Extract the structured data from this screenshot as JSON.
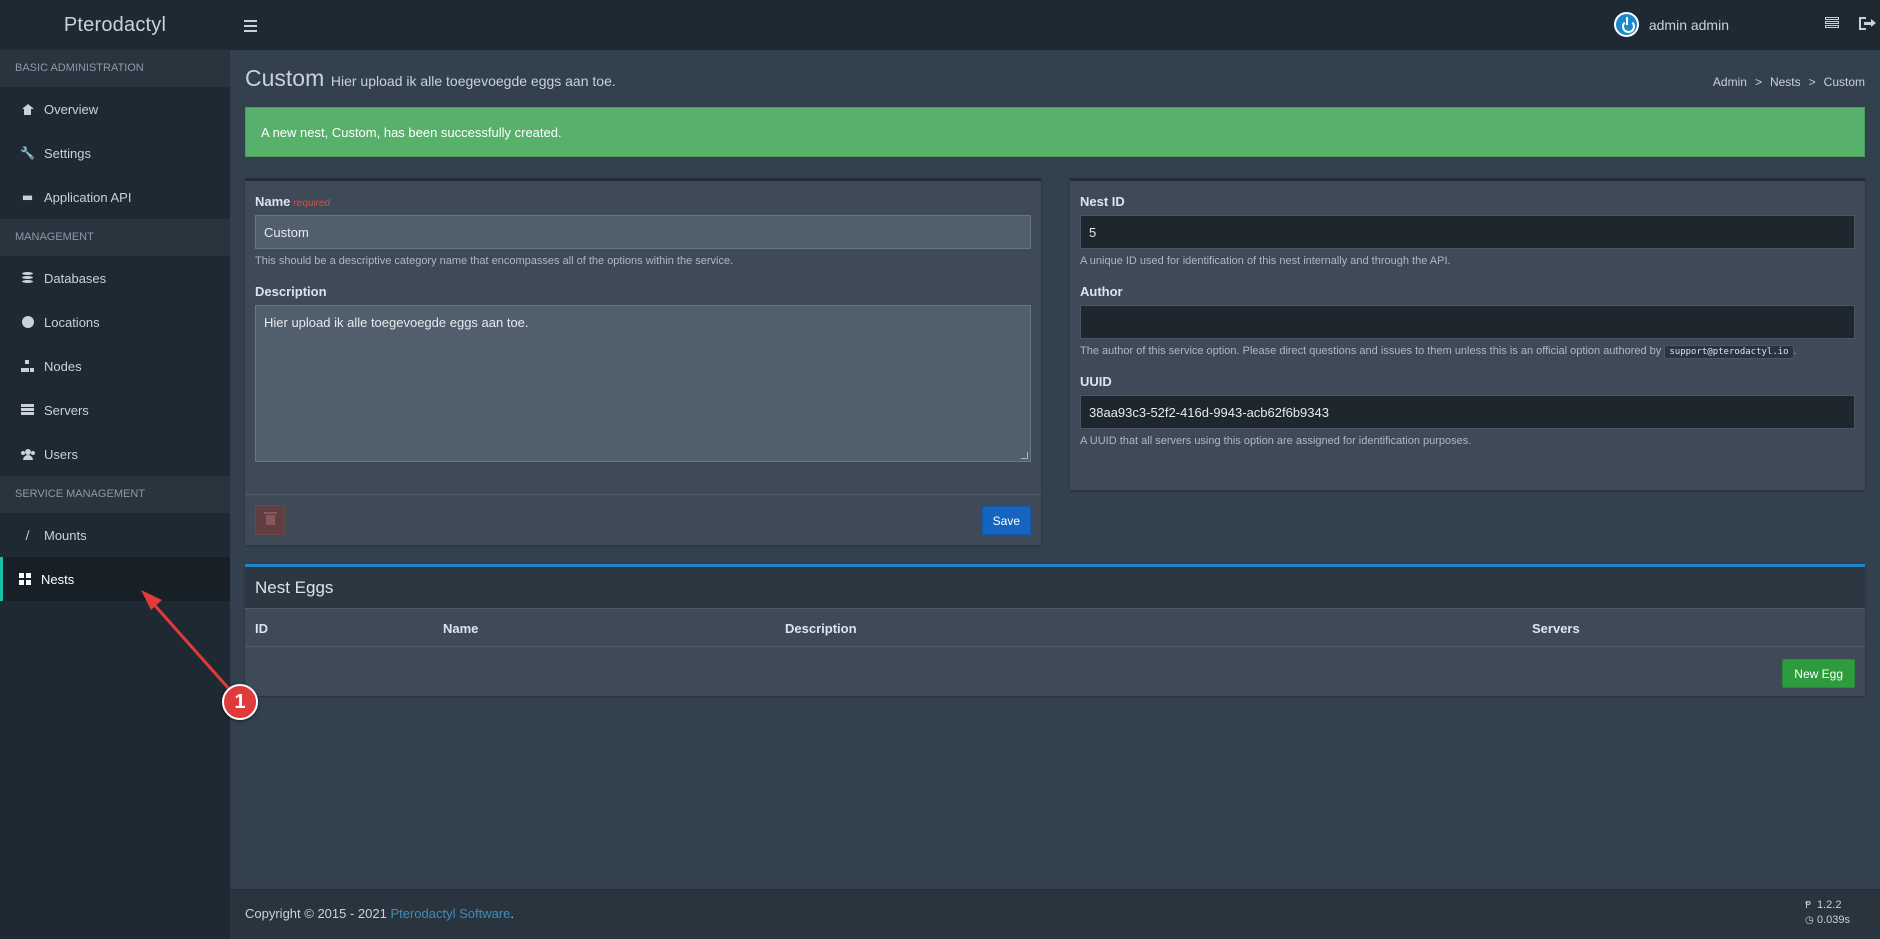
{
  "app": {
    "brand": "Pterodactyl"
  },
  "header": {
    "user_name": "admin admin"
  },
  "sidebar": {
    "sections": [
      {
        "title": "BASIC ADMINISTRATION",
        "items": [
          {
            "label": "Overview"
          },
          {
            "label": "Settings"
          },
          {
            "label": "Application API"
          }
        ]
      },
      {
        "title": "MANAGEMENT",
        "items": [
          {
            "label": "Databases"
          },
          {
            "label": "Locations"
          },
          {
            "label": "Nodes"
          },
          {
            "label": "Servers"
          },
          {
            "label": "Users"
          }
        ]
      },
      {
        "title": "SERVICE MANAGEMENT",
        "items": [
          {
            "label": "Mounts"
          },
          {
            "label": "Nests",
            "active": true
          }
        ]
      }
    ]
  },
  "page": {
    "title": "Custom",
    "subtitle": "Hier upload ik alle toegevoegde eggs aan toe.",
    "breadcrumb": [
      "Admin",
      "Nests",
      "Custom"
    ]
  },
  "alert": {
    "message": "A new nest, Custom, has been successfully created."
  },
  "nest_form": {
    "name_label": "Name",
    "name_required": "required",
    "name_value": "Custom",
    "name_help": "This should be a descriptive category name that encompasses all of the options within the service.",
    "description_label": "Description",
    "description_value": "Hier upload ik alle toegevoegde eggs aan toe.",
    "save_label": "Save"
  },
  "nest_info": {
    "id_label": "Nest ID",
    "id_value": "5",
    "id_help": "A unique ID used for identification of this nest internally and through the API.",
    "author_label": "Author",
    "author_value": "",
    "author_help": "The author of this service option. Please direct questions and issues to them unless this is an official option authored by",
    "author_help_code": "support@pterodactyl.io",
    "author_help_end": ".",
    "uuid_label": "UUID",
    "uuid_value": "38aa93c3-52f2-416d-9943-acb62f6b9343",
    "uuid_help": "A UUID that all servers using this option are assigned for identification purposes."
  },
  "eggs": {
    "title": "Nest Eggs",
    "columns": [
      "ID",
      "Name",
      "Description",
      "Servers"
    ],
    "rows": [],
    "new_label": "New Egg"
  },
  "footer": {
    "copyright": "Copyright © 2015 - 2021",
    "link": "Pterodactyl Software",
    "period": ".",
    "version": "1.2.2",
    "time": "0.039s"
  },
  "annotation": {
    "number": "1",
    "color": "#e03a3a"
  },
  "colors": {
    "accent": "#19c2a6",
    "success": "#58b16a",
    "primary": "#1565c0",
    "new_egg": "#2d9c3e"
  }
}
